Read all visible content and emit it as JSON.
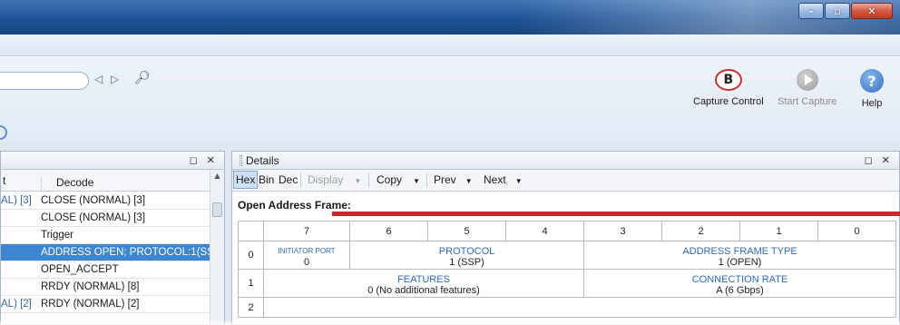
{
  "toolbar": {
    "capture_control": "Capture Control",
    "start_capture": "Start Capture",
    "help": "Help",
    "capture_glyph": "B",
    "help_glyph": "?"
  },
  "left_pane": {
    "columns": [
      "t",
      "Decode"
    ],
    "rows": [
      {
        "a": "AL) [3]",
        "decode": "CLOSE (NORMAL) [3]"
      },
      {
        "a": "",
        "decode": "CLOSE (NORMAL) [3]"
      },
      {
        "a": "",
        "decode": "Trigger"
      },
      {
        "a": "",
        "decode": "ADDRESS OPEN; PROTOCOL:1(SSP",
        "selected": true
      },
      {
        "a": "",
        "decode": "OPEN_ACCEPT"
      },
      {
        "a": "",
        "decode": "RRDY (NORMAL) [8]"
      },
      {
        "a": "AL) [2]",
        "decode": "RRDY (NORMAL) [2]"
      }
    ]
  },
  "details": {
    "title": "Details",
    "toolbar": {
      "hex": "Hex",
      "bin": "Bin",
      "dec": "Dec",
      "display": "Display",
      "copy": "Copy",
      "prev": "Prev",
      "next": "Next"
    },
    "frame_title": "Open Address Frame:",
    "bits": [
      "7",
      "6",
      "5",
      "4",
      "3",
      "2",
      "1",
      "0"
    ],
    "row0": {
      "idx": "0",
      "initiator_port": {
        "label": "INITIATOR PORT",
        "value": "0"
      },
      "protocol": {
        "label": "PROTOCOL",
        "value": "1 (SSP)"
      },
      "address_frame_type": {
        "label": "ADDRESS FRAME TYPE",
        "value": "1 (OPEN)"
      }
    },
    "row1": {
      "idx": "1",
      "features": {
        "label": "FEATURES",
        "value": "0 (No additional features)"
      },
      "connection_rate": {
        "label": "CONNECTION RATE",
        "value": "A (6 Gbps)"
      }
    },
    "row2": {
      "idx": "2"
    }
  },
  "colors": {
    "accent": "#3d86d0",
    "field_label": "#2c6db8",
    "marker": "#d2232a"
  }
}
